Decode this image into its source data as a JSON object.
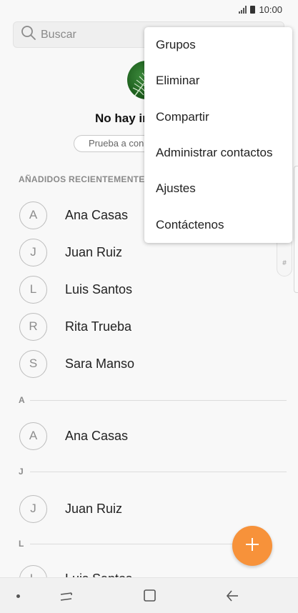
{
  "status_bar": {
    "time": "10:00"
  },
  "search": {
    "placeholder": "Buscar"
  },
  "empty_state": {
    "title": "No hay in",
    "try_label": "Prueba a con"
  },
  "recent": {
    "header": "AÑADIDOS RECIENTEMENTE",
    "contacts": [
      {
        "initial": "A",
        "name": "Ana Casas"
      },
      {
        "initial": "J",
        "name": "Juan Ruiz"
      },
      {
        "initial": "L",
        "name": "Luis Santos"
      },
      {
        "initial": "R",
        "name": "Rita Trueba"
      },
      {
        "initial": "S",
        "name": "Sara Manso"
      }
    ]
  },
  "sections": [
    {
      "letter": "A",
      "contact": {
        "initial": "A",
        "name": "Ana Casas"
      }
    },
    {
      "letter": "J",
      "contact": {
        "initial": "J",
        "name": "Juan Ruiz"
      }
    },
    {
      "letter": "L",
      "contact": {
        "initial": "L",
        "name": "Luis Santos"
      }
    }
  ],
  "scroll_index": {
    "label": "#"
  },
  "menu": {
    "items": [
      "Grupos",
      "Eliminar",
      "Compartir",
      "Administrar contactos",
      "Ajustes",
      "Contáctenos"
    ]
  },
  "colors": {
    "fab": "#f7923a",
    "background": "#f8f8f8",
    "menu": "#ffffff"
  },
  "icons": {
    "search": "search-icon",
    "fab": "plus-icon",
    "nav_recents": "recent-apps-icon",
    "nav_home": "home-icon",
    "nav_back": "back-icon"
  }
}
